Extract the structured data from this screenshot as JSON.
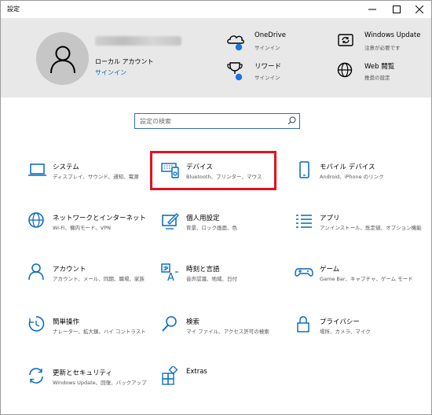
{
  "window": {
    "title": "設定"
  },
  "account": {
    "type_label": "ローカル アカウント",
    "signin_link": "サインイン"
  },
  "header_items": [
    {
      "id": "onedrive",
      "title": "OneDrive",
      "sub": "サインイン"
    },
    {
      "id": "windows-update",
      "title": "Windows Update",
      "sub": "注意が必要です"
    },
    {
      "id": "rewards",
      "title": "リワード",
      "sub": "サインイン"
    },
    {
      "id": "web-browsing",
      "title": "Web 閲覧",
      "sub": "推奨の設定"
    }
  ],
  "search": {
    "placeholder": "設定の検索"
  },
  "tiles": [
    {
      "id": "system",
      "title": "システム",
      "sub": "ディスプレイ、サウンド、通知、電源",
      "icon": "laptop-icon"
    },
    {
      "id": "devices",
      "title": "デバイス",
      "sub": "Bluetooth、プリンター、マウス",
      "icon": "keyboard-speaker-icon"
    },
    {
      "id": "phone",
      "title": "モバイル デバイス",
      "sub": "Android、iPhone のリンク",
      "icon": "phone-icon"
    },
    {
      "id": "network",
      "title": "ネットワークとインターネット",
      "sub": "Wi-Fi、機内モード、VPN",
      "icon": "globe-icon"
    },
    {
      "id": "personalization",
      "title": "個人用設定",
      "sub": "背景、ロック画面、色",
      "icon": "paint-icon"
    },
    {
      "id": "apps",
      "title": "アプリ",
      "sub": "アンインストール、既定値、オプション機能",
      "icon": "apps-list-icon"
    },
    {
      "id": "accounts",
      "title": "アカウント",
      "sub": "アカウント、メール、同期、職場、家族",
      "icon": "person-icon"
    },
    {
      "id": "time-language",
      "title": "時刻と言語",
      "sub": "音声認識、地域、日付",
      "icon": "time-language-icon"
    },
    {
      "id": "gaming",
      "title": "ゲーム",
      "sub": "Game Bar、キャプチャ、ゲーム モード",
      "icon": "gamepad-icon"
    },
    {
      "id": "ease-of-access",
      "title": "簡単操作",
      "sub": "ナレーター、拡大鏡、ハイ コントラスト",
      "icon": "ease-of-access-icon"
    },
    {
      "id": "search-settings",
      "title": "検索",
      "sub": "マイ ファイル、アクセス許可の検索",
      "icon": "magnifier-icon"
    },
    {
      "id": "privacy",
      "title": "プライバシー",
      "sub": "場所、カメラ、マイク",
      "icon": "lock-icon"
    },
    {
      "id": "update-security",
      "title": "更新とセキュリティ",
      "sub": "Windows Update、回復、バックアップ",
      "icon": "sync-icon"
    },
    {
      "id": "extras",
      "title": "Extras",
      "sub": "",
      "icon": "extras-icon"
    }
  ],
  "colors": {
    "accent": "#0067c0",
    "badge": "#1a73e8",
    "highlight": "#e3121e",
    "header_bg": "#e8e8e8"
  }
}
